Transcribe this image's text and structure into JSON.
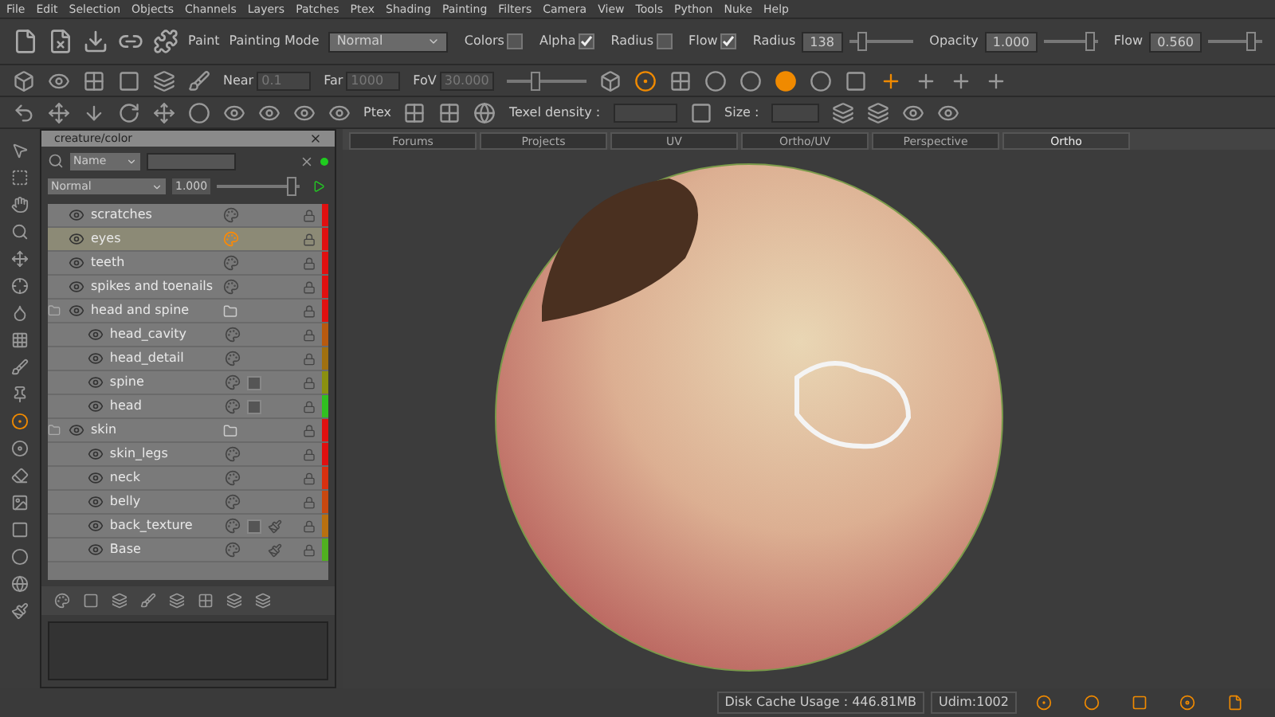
{
  "menu": [
    "File",
    "Edit",
    "Selection",
    "Objects",
    "Channels",
    "Layers",
    "Patches",
    "Ptex",
    "Shading",
    "Painting",
    "Filters",
    "Camera",
    "View",
    "Tools",
    "Python",
    "Nuke",
    "Help"
  ],
  "paint_toolbar": {
    "label": "Paint",
    "mode_label": "Painting Mode",
    "mode": "Normal",
    "toggles": [
      {
        "label": "Colors",
        "checked": false
      },
      {
        "label": "Alpha",
        "checked": true
      },
      {
        "label": "Radius",
        "checked": false
      },
      {
        "label": "Flow",
        "checked": true
      }
    ],
    "sliders": [
      {
        "label": "Radius",
        "value": "138",
        "level": 0.15
      },
      {
        "label": "Opacity",
        "value": "1.000",
        "level": 0.95
      },
      {
        "label": "Flow",
        "value": "0.560",
        "level": 0.85
      }
    ]
  },
  "camera_toolbar": {
    "fields": [
      {
        "label": "Near",
        "value": "0.1",
        "disabled": true
      },
      {
        "label": "Far",
        "value": "1000",
        "disabled": true
      },
      {
        "label": "FoV",
        "value": "30.000",
        "disabled": true
      }
    ],
    "fov_slider": {
      "level": 0.35
    }
  },
  "ptex_toolbar": {
    "label": "Ptex",
    "texel_label": "Texel density :",
    "size_label": "Size :"
  },
  "layers_panel": {
    "title": "creature/color",
    "filter": "Name",
    "blend": "Normal",
    "opacity": "1.000",
    "opacity_slider": {
      "level": 0.95
    },
    "layers": [
      {
        "name": "scratches",
        "kind": "layer",
        "selected": false,
        "color": "#e01010",
        "mask": false,
        "adjustment": false
      },
      {
        "name": "eyes",
        "kind": "layer",
        "selected": true,
        "color": "#e01010",
        "mask": false,
        "adjustment": false
      },
      {
        "name": "teeth",
        "kind": "layer",
        "selected": false,
        "color": "#e01010",
        "mask": false,
        "adjustment": false
      },
      {
        "name": "spikes and toenails",
        "kind": "layer",
        "selected": false,
        "color": "#e01010",
        "mask": false,
        "adjustment": false
      },
      {
        "name": "head and spine",
        "kind": "group",
        "selected": false,
        "color": "#e01010",
        "mask": false,
        "adjustment": false,
        "children": [
          {
            "name": "head_cavity",
            "kind": "layer",
            "selected": false,
            "color": "#b85a10",
            "mask": false,
            "adjustment": false
          },
          {
            "name": "head_detail",
            "kind": "layer",
            "selected": false,
            "color": "#a07010",
            "mask": false,
            "adjustment": false
          },
          {
            "name": "spine",
            "kind": "layer",
            "selected": false,
            "color": "#8a9010",
            "mask": true,
            "adjustment": false
          },
          {
            "name": "head",
            "kind": "layer",
            "selected": false,
            "color": "#30c020",
            "mask": true,
            "adjustment": false
          }
        ]
      },
      {
        "name": "skin",
        "kind": "group",
        "selected": false,
        "color": "#e01010",
        "mask": false,
        "adjustment": false,
        "children": [
          {
            "name": "skin_legs",
            "kind": "layer",
            "selected": false,
            "color": "#e01010",
            "mask": false,
            "adjustment": false
          },
          {
            "name": "neck",
            "kind": "layer",
            "selected": false,
            "color": "#d83010",
            "mask": false,
            "adjustment": false
          },
          {
            "name": "belly",
            "kind": "layer",
            "selected": false,
            "color": "#c84810",
            "mask": false,
            "adjustment": false
          },
          {
            "name": "back_texture",
            "kind": "layer",
            "selected": false,
            "color": "#b87010",
            "mask": true,
            "adjustment": true
          },
          {
            "name": "Base",
            "kind": "layer",
            "selected": false,
            "color": "#50b020",
            "mask": false,
            "adjustment": true
          }
        ]
      }
    ]
  },
  "view_tabs": [
    {
      "label": "Forums",
      "selected": false
    },
    {
      "label": "Projects",
      "selected": false
    },
    {
      "label": "UV",
      "selected": false
    },
    {
      "label": "Ortho/UV",
      "selected": false
    },
    {
      "label": "Perspective",
      "selected": false
    },
    {
      "label": "Ortho",
      "selected": true
    }
  ],
  "status_bar": {
    "cache": "Disk Cache Usage : 446.81MB",
    "udim": "Udim:1002"
  }
}
